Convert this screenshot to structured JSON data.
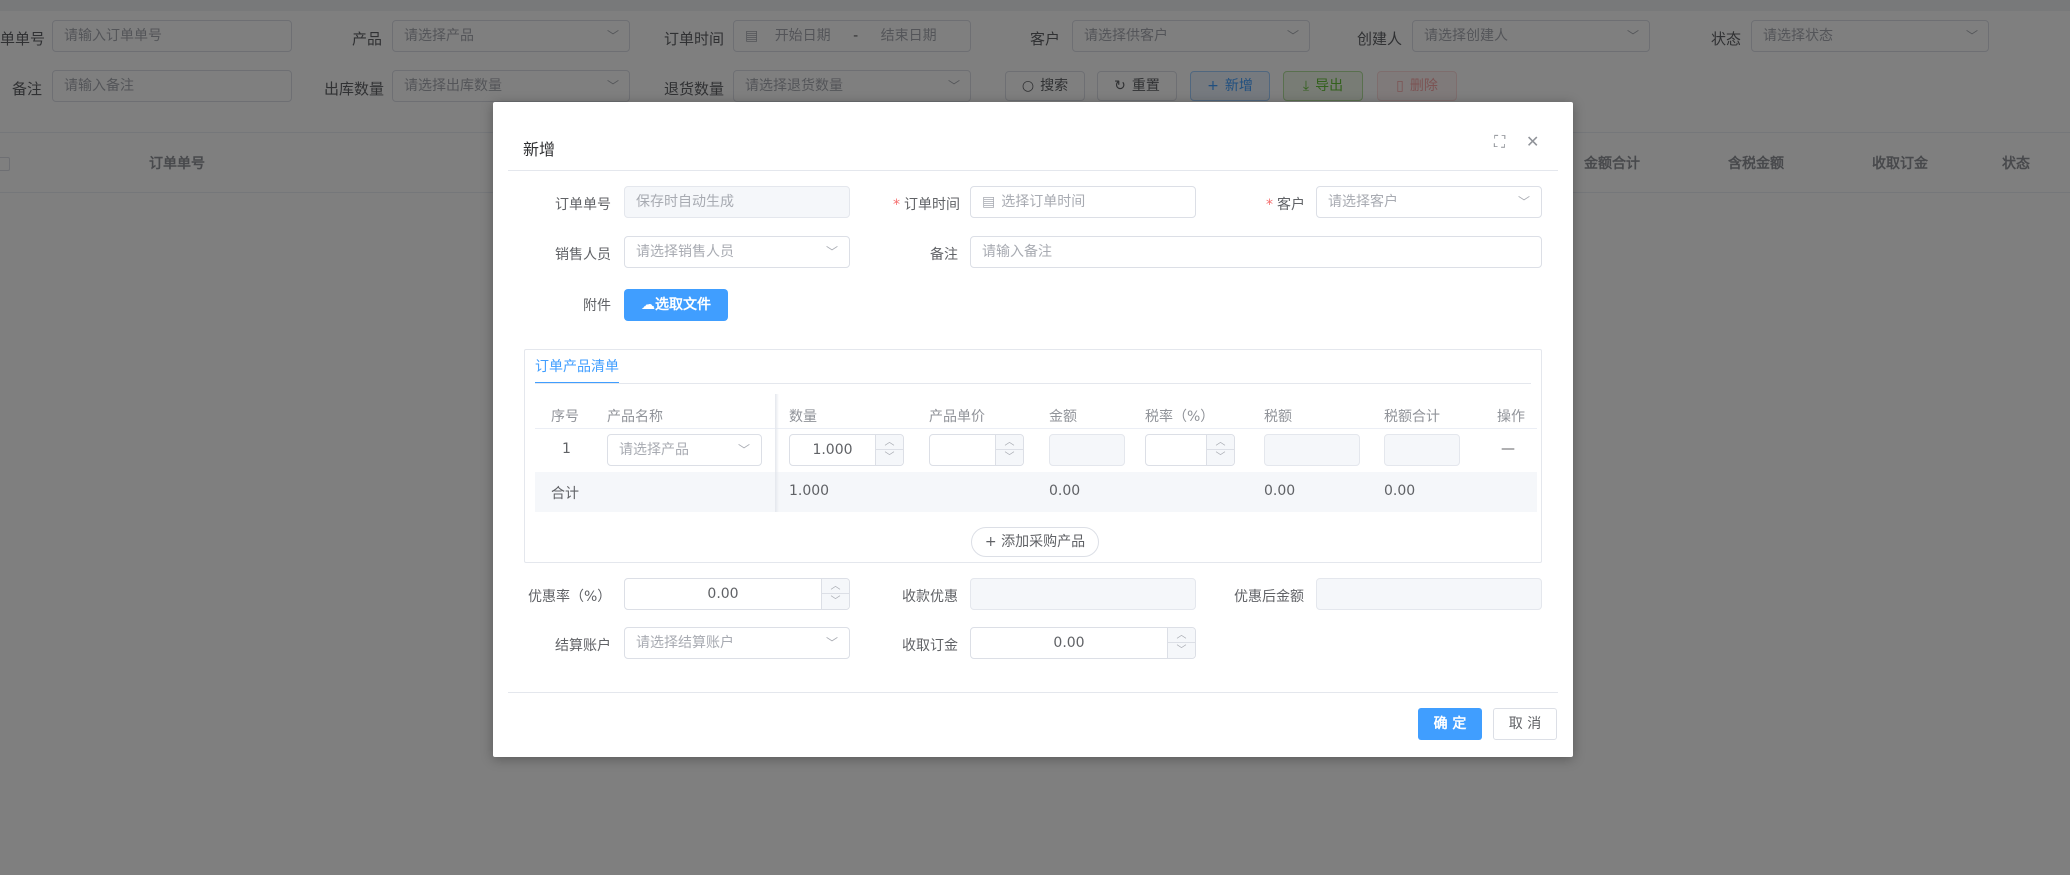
{
  "filters": {
    "order_no_label": "单单号",
    "order_no_placeholder": "请输入订单单号",
    "product_label": "产品",
    "product_placeholder": "请选择产品",
    "order_time_label": "订单时间",
    "start_date_placeholder": "开始日期",
    "date_separator": "-",
    "end_date_placeholder": "结束日期",
    "customer_label": "客户",
    "customer_placeholder": "请选择供客户",
    "creator_label": "创建人",
    "creator_placeholder": "请选择创建人",
    "status_label": "状态",
    "status_placeholder": "请选择状态",
    "remark_label": "备注",
    "remark_placeholder": "请输入备注",
    "out_qty_label": "出库数量",
    "out_qty_placeholder": "请选择出库数量",
    "return_qty_label": "退货数量",
    "return_qty_placeholder": "请选择退货数量"
  },
  "toolbar": {
    "search": "搜索",
    "reset": "重置",
    "add": "新增",
    "export": "导出",
    "delete": "删除"
  },
  "main_table": {
    "columns": [
      "订单单号",
      "金额合计",
      "含税金额",
      "收取订金",
      "状态"
    ]
  },
  "dialog": {
    "title": "新增",
    "order_no_label": "订单单号",
    "order_no_placeholder": "保存时自动生成",
    "order_time_label": "订单时间",
    "order_time_placeholder": "选择订单时间",
    "customer_label": "客户",
    "customer_placeholder": "请选择客户",
    "sales_label": "销售人员",
    "sales_placeholder": "请选择销售人员",
    "remark_label": "备注",
    "remark_placeholder": "请输入备注",
    "attachment_label": "附件",
    "upload_button": "选取文件",
    "tab_label": "订单产品清单",
    "grid": {
      "headers": [
        "序号",
        "产品名称",
        "数量",
        "产品单价",
        "金额",
        "税率（%）",
        "税额",
        "税额合计",
        "操作"
      ],
      "row": {
        "index": "1",
        "product_placeholder": "请选择产品",
        "quantity": "1.000",
        "action": "—"
      },
      "summary": {
        "label": "合计",
        "quantity": "1.000",
        "amount": "0.00",
        "tax": "0.00",
        "tax_total": "0.00"
      }
    },
    "add_product_button": "+ 添加采购产品",
    "discount_rate_label": "优惠率（%）",
    "discount_rate_value": "0.00",
    "collect_discount_label": "收款优惠",
    "after_discount_label": "优惠后金额",
    "account_label": "结算账户",
    "account_placeholder": "请选择结算账户",
    "deposit_label": "收取订金",
    "deposit_value": "0.00",
    "confirm_button": "确 定",
    "cancel_button": "取 消"
  }
}
